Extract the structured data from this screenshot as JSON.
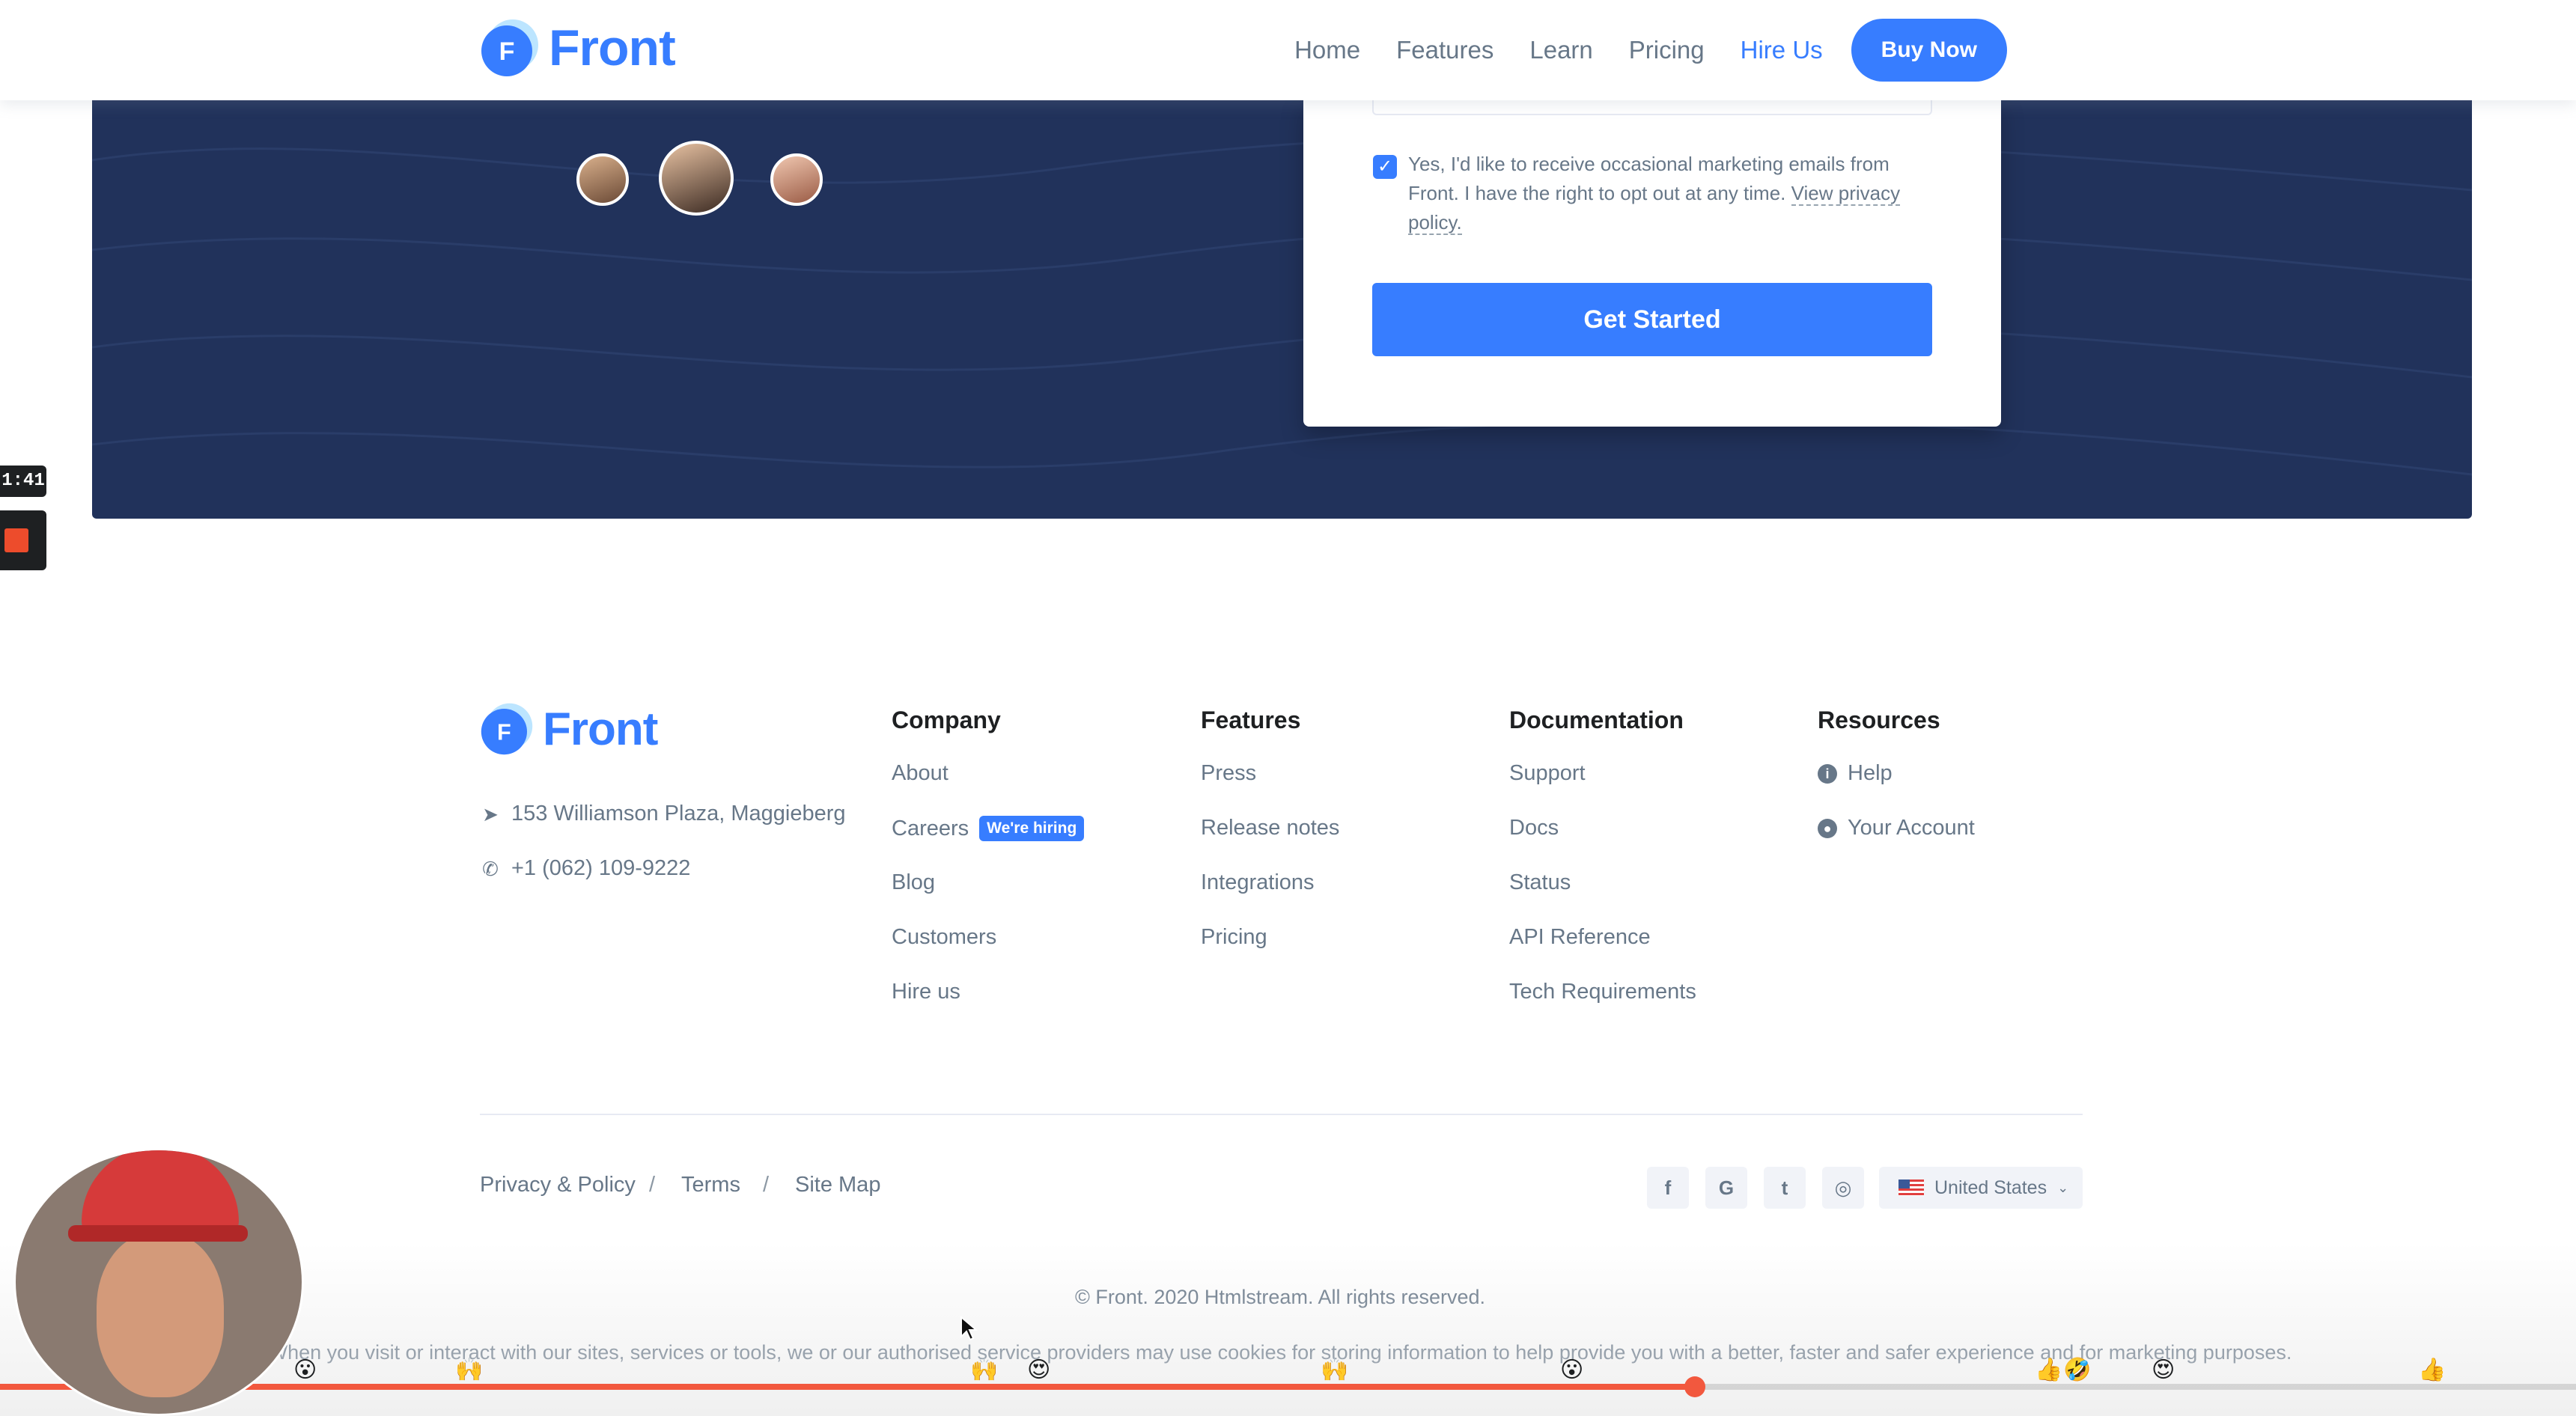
{
  "brand": {
    "name": "Front",
    "mark_letter": "F",
    "accent": "#377dff",
    "navy": "#21325b"
  },
  "nav": {
    "items": [
      "Home",
      "Features",
      "Learn",
      "Pricing",
      "Hire Us"
    ],
    "active": "Hire Us",
    "buy_now": "Buy Now"
  },
  "signup": {
    "consent_text": "Yes, I'd like to receive occasional marketing emails from Front. I have the right to opt out at any time.",
    "consent_link": "View privacy policy.",
    "consent_checked": true,
    "submit_label": "Get Started"
  },
  "recorder": {
    "time": "1:41"
  },
  "footer": {
    "address": "153 Williamson Plaza, Maggieberg",
    "phone": "+1 (062) 109-9222",
    "columns": [
      {
        "title": "Company",
        "links": [
          "About",
          "Careers",
          "Blog",
          "Customers",
          "Hire us"
        ],
        "badge": "We're hiring"
      },
      {
        "title": "Features",
        "links": [
          "Press",
          "Release notes",
          "Integrations",
          "Pricing"
        ]
      },
      {
        "title": "Documentation",
        "links": [
          "Support",
          "Docs",
          "Status",
          "API Reference",
          "Tech Requirements"
        ]
      },
      {
        "title": "Resources",
        "links": [
          "Help",
          "Your Account"
        ]
      }
    ],
    "legal": [
      "Privacy & Policy",
      "Terms",
      "Site Map"
    ],
    "legal_separator": "/",
    "social": [
      {
        "icon": "facebook-icon",
        "glyph": "f"
      },
      {
        "icon": "google-icon",
        "glyph": "G"
      },
      {
        "icon": "twitter-icon",
        "glyph": "t"
      },
      {
        "icon": "github-icon",
        "glyph": "◎"
      }
    ],
    "country": "United States",
    "copyright": "© Front. 2020 Htmlstream. All rights reserved.",
    "cookie_notice": "When you visit or interact with our sites, services or tools, we or our authorised service providers may use cookies for storing information to help provide you with a better, faster and safer experience and for marketing purposes."
  },
  "video": {
    "progress": 0.658
  }
}
